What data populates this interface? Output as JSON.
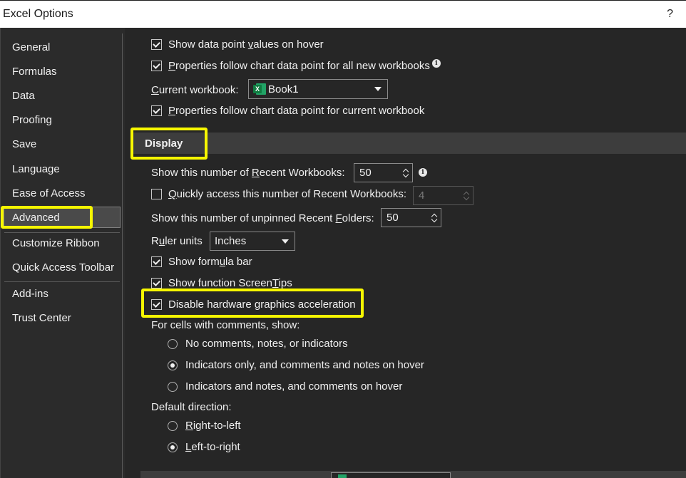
{
  "window": {
    "title": "Excel Options",
    "help": "?"
  },
  "sidebar": {
    "items": [
      {
        "label": "General"
      },
      {
        "label": "Formulas"
      },
      {
        "label": "Data"
      },
      {
        "label": "Proofing"
      },
      {
        "label": "Save"
      },
      {
        "label": "Language"
      },
      {
        "label": "Ease of Access"
      },
      {
        "label": "Advanced",
        "selected": true
      },
      {
        "label": "Customize Ribbon"
      },
      {
        "label": "Quick Access Toolbar"
      },
      {
        "label": "Add-ins"
      },
      {
        "label": "Trust Center"
      }
    ]
  },
  "chart_options": {
    "show_values_hover": {
      "pre": "Show data point ",
      "u": "v",
      "post": "alues on hover",
      "checked": true
    },
    "props_all_new": {
      "pre": "",
      "u": "P",
      "post": "roperties follow chart data point for all new workbooks",
      "checked": true
    },
    "current_workbook_label": {
      "pre": "",
      "u": "C",
      "post": "urrent workbook:"
    },
    "current_workbook_value": "Book1",
    "props_current": {
      "pre": "",
      "u": "P",
      "post": "roperties follow chart data point for current workbook",
      "checked": true
    }
  },
  "display": {
    "section_title": "Display",
    "recent_workbooks": {
      "pre": "Show this number of ",
      "u": "R",
      "post": "ecent Workbooks:",
      "value": "50"
    },
    "quick_access": {
      "pre": "",
      "u": "Q",
      "post": "uickly access this number of Recent Workbooks:",
      "value": "4",
      "checked": false
    },
    "unpinned_folders": {
      "pre": "Show this number of unpinned Recent ",
      "u": "F",
      "post": "olders:",
      "value": "50"
    },
    "ruler_units": {
      "pre": "R",
      "u": "u",
      "post": "ler units",
      "value": "Inches"
    },
    "formula_bar": {
      "pre": "Show form",
      "u": "u",
      "post": "la bar",
      "checked": true
    },
    "screentips": {
      "pre": "Show function Screen",
      "u": "T",
      "post": "ips",
      "checked": true
    },
    "hw_accel": {
      "pre": "Disable hardware ",
      "u": "g",
      "post": "raphics acceleration",
      "checked": true
    },
    "comments_label": "For cells with comments, show:",
    "comments_options": [
      {
        "label": "No comments, notes, or indicators",
        "selected": false
      },
      {
        "label": "Indicators only, and comments and notes on hover",
        "selected": true
      },
      {
        "label": "Indicators and notes, and comments on hover",
        "selected": false
      }
    ],
    "direction_label": "Default direction:",
    "direction_options": [
      {
        "pre": "",
        "u": "R",
        "post": "ight-to-left",
        "selected": false
      },
      {
        "pre": "",
        "u": "L",
        "post": "eft-to-right",
        "selected": true
      }
    ]
  },
  "colors": {
    "highlight": "#f7f700",
    "bg": "#262626",
    "section_bar": "#3d3d3d",
    "excel_green": "#107c41"
  },
  "icons": {
    "info": "info-icon",
    "excel": "excel-workbook-icon",
    "help": "help-icon"
  }
}
